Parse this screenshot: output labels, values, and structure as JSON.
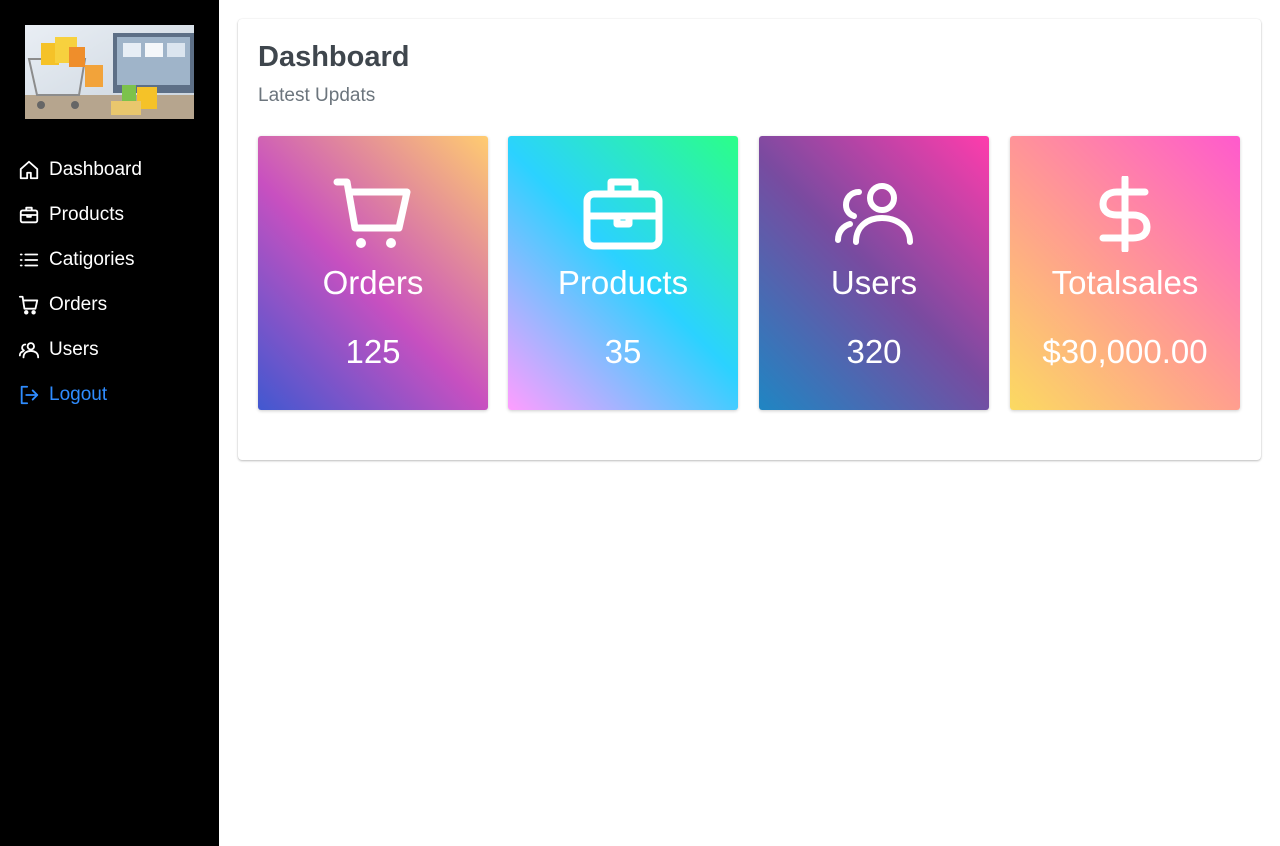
{
  "sidebar": {
    "logo_alt": "shop logo",
    "items": [
      {
        "label": "Dashboard",
        "icon": "house-icon"
      },
      {
        "label": "Products",
        "icon": "briefcase-icon"
      },
      {
        "label": "Catigories",
        "icon": "list-icon"
      },
      {
        "label": "Orders",
        "icon": "cart-icon"
      },
      {
        "label": "Users",
        "icon": "users-icon"
      },
      {
        "label": "Logout",
        "icon": "logout-icon"
      }
    ],
    "logout_color": "#2f8cff"
  },
  "main": {
    "title": "Dashboard",
    "subtitle": "Latest Updats",
    "cards": [
      {
        "label": "Orders",
        "value": "125",
        "icon": "cart-icon"
      },
      {
        "label": "Products",
        "value": "35",
        "icon": "briefcase-icon"
      },
      {
        "label": "Users",
        "value": "320",
        "icon": "users-icon"
      },
      {
        "label": "Totalsales",
        "value": "$30,000.00",
        "icon": "dollar-icon"
      }
    ]
  }
}
